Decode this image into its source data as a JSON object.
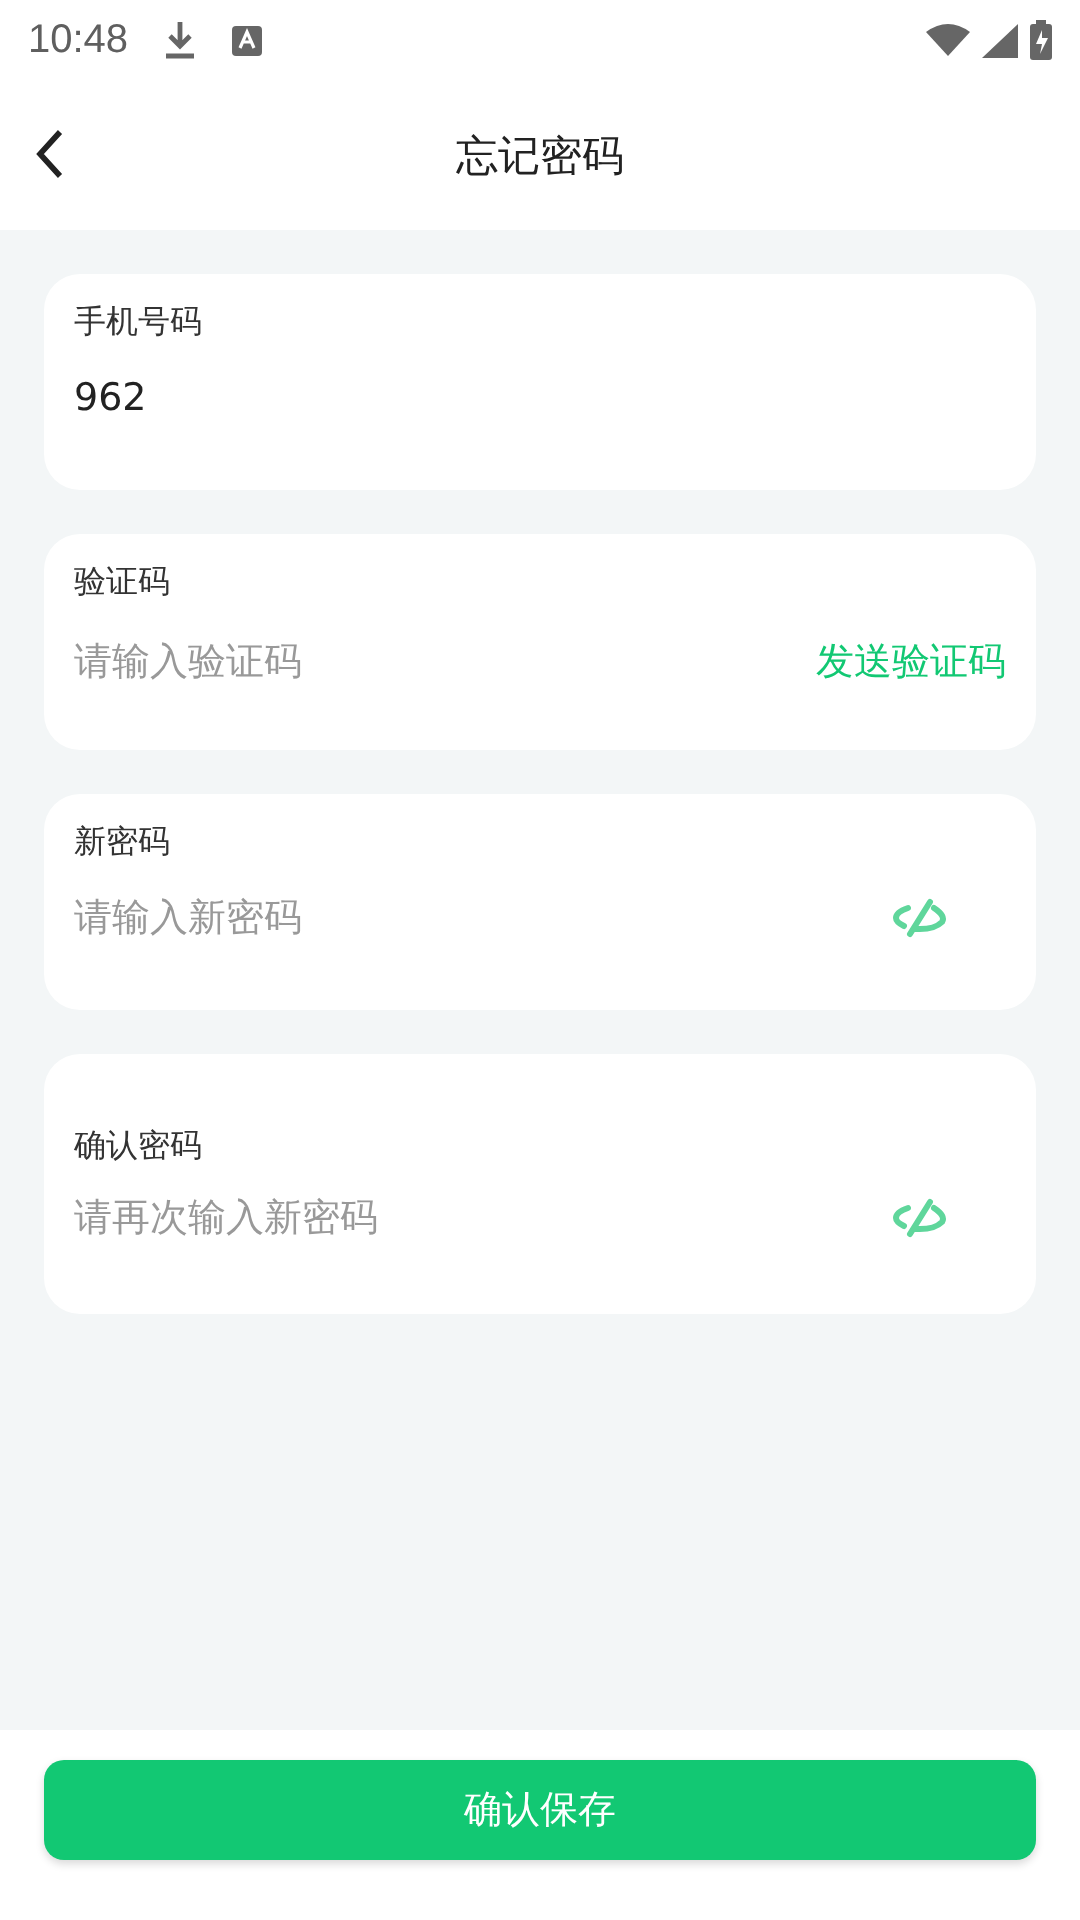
{
  "status_bar": {
    "time": "10:48"
  },
  "header": {
    "title": "忘记密码"
  },
  "fields": [
    {
      "kind": "text",
      "label": "手机号码",
      "value": "962"
    },
    {
      "kind": "code",
      "label": "验证码",
      "placeholder": "请输入验证码",
      "action": "发送验证码"
    },
    {
      "kind": "password",
      "label": "新密码",
      "placeholder": "请输入新密码"
    },
    {
      "kind": "confirm",
      "label": "确认密码",
      "placeholder": "请再次输入新密码"
    }
  ],
  "submit": {
    "label": "确认保存"
  }
}
